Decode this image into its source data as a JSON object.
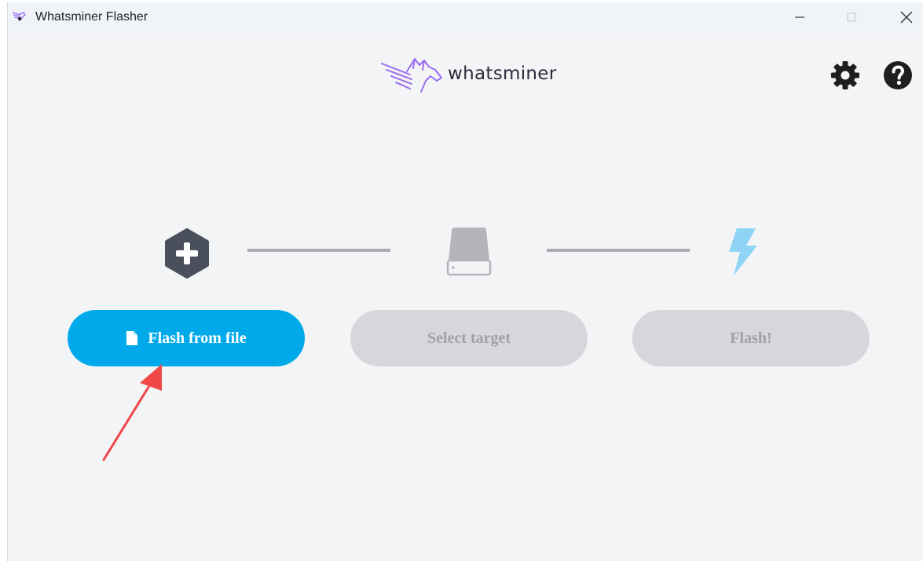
{
  "window": {
    "title": "Whatsminer Flasher",
    "controls": {
      "minimize": "minimize-icon",
      "maximize": "maximize-icon",
      "close": "close-icon"
    }
  },
  "header": {
    "logo_text": "whatsminer",
    "settings_icon": "gear-icon",
    "help_icon": "question-icon"
  },
  "steps": [
    {
      "icon": "plus-hexagon-icon",
      "button_label": "Flash from file",
      "button_icon": "file-icon",
      "enabled": true
    },
    {
      "icon": "drive-icon",
      "button_label": "Select target",
      "enabled": false
    },
    {
      "icon": "lightning-icon",
      "button_label": "Flash!",
      "enabled": false
    }
  ],
  "colors": {
    "accent": "#00aaea",
    "disabled_button": "#d6d7db",
    "disabled_text": "#9fa1a7",
    "dark_icon": "#4a4f5c",
    "lightning": "#8fd3f5",
    "logo_purple": "#9b6cf0",
    "annotation_arrow": "#f04848"
  }
}
